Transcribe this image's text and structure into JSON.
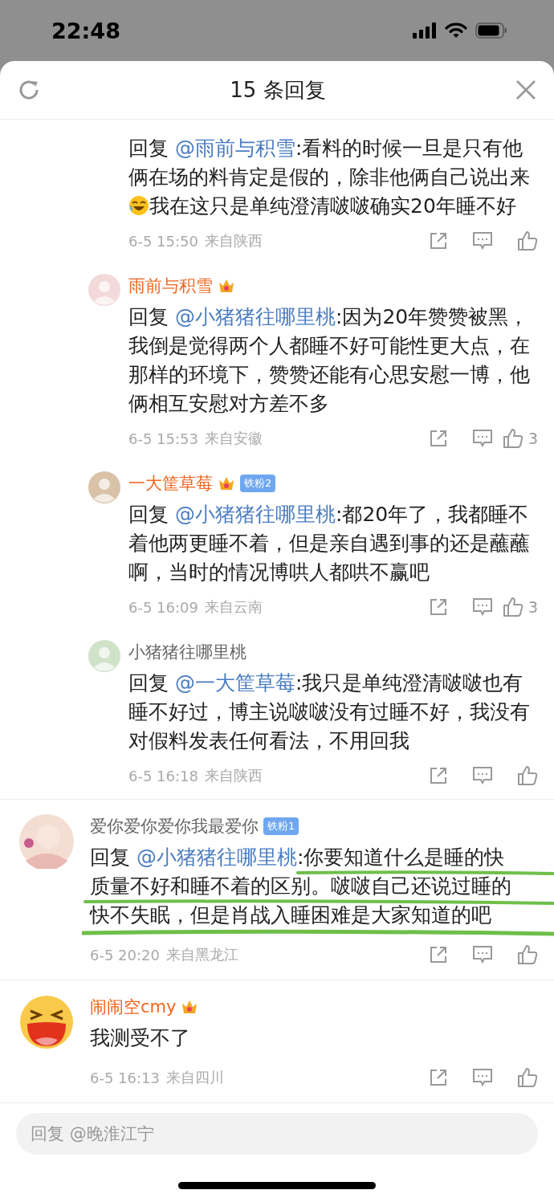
{
  "status_bar": {
    "time": "22:48"
  },
  "header": {
    "title": "15 条回复"
  },
  "partial_thread": {
    "replies": [
      {
        "segments": [
          {
            "kind": "text",
            "text": "回复 "
          },
          {
            "kind": "mention",
            "text": "@雨前与积雪"
          },
          {
            "kind": "text",
            "text": ":看料的时候一旦是只有他俩在场的料肯定是假的，除非他俩自己说出来"
          },
          {
            "kind": "emoji"
          },
          {
            "kind": "text",
            "text": "我在这只是单纯澄清啵啵确实20年睡不好"
          }
        ],
        "time": "6-5 15:50",
        "location": "来自陕西"
      },
      {
        "name": "雨前与积雪",
        "vip": true,
        "segments": [
          {
            "kind": "text",
            "text": "回复 "
          },
          {
            "kind": "mention",
            "text": "@小猪猪往哪里桃"
          },
          {
            "kind": "text",
            "text": ":因为20年赞赞被黑，我倒是觉得两个人都睡不好可能性更大点，在那样的环境下，赞赞还能有心思安慰一博，他俩相互安慰对方差不多"
          }
        ],
        "time": "6-5 15:53",
        "location": "来自安徽",
        "likes": "3"
      },
      {
        "name": "一大筐草莓",
        "vip": true,
        "fan_badge": "铁粉2",
        "segments": [
          {
            "kind": "text",
            "text": "回复 "
          },
          {
            "kind": "mention",
            "text": "@小猪猪往哪里桃"
          },
          {
            "kind": "text",
            "text": ":都20年了，我都睡不着他两更睡不着，但是亲自遇到事的还是蘸蘸啊，当时的情况博哄人都哄不赢吧"
          }
        ],
        "time": "6-5 16:09",
        "location": "来自云南",
        "likes": "3"
      },
      {
        "name": "小猪猪往哪里桃",
        "vip": false,
        "segments": [
          {
            "kind": "text",
            "text": "回复 "
          },
          {
            "kind": "mention",
            "text": "@一大筐草莓"
          },
          {
            "kind": "text",
            "text": ":我只是单纯澄清啵啵也有睡不好过，博主说啵啵没有过睡不好，我没有对假料发表任何看法，不用回我"
          }
        ],
        "time": "6-5 16:18",
        "location": "来自陕西"
      }
    ]
  },
  "comments": [
    {
      "kind": "photo",
      "name": "爱你爱你爱你我最爱你",
      "vip": false,
      "fan_badge": "铁粉1",
      "underlined": true,
      "segments": [
        {
          "kind": "text",
          "text": "回复 "
        },
        {
          "kind": "mention",
          "text": "@小猪猪往哪里桃"
        },
        {
          "kind": "text",
          "text": ":你要知道什么是睡的快质量不好和睡不着的区别。啵啵自己还说过睡的快不失眠，但是肖战入睡困难是大家知道的吧"
        }
      ],
      "time": "6-5 20:20",
      "location": "来自黑龙江"
    },
    {
      "kind": "emoji",
      "name": "闹闹空cmy",
      "vip": true,
      "underlined": false,
      "segments": [
        {
          "kind": "text",
          "text": "我测受不了"
        }
      ],
      "time": "6-5 16:13",
      "location": "来自四川"
    }
  ],
  "reply_box": {
    "placeholder": "回复 @晚淮江宁"
  }
}
